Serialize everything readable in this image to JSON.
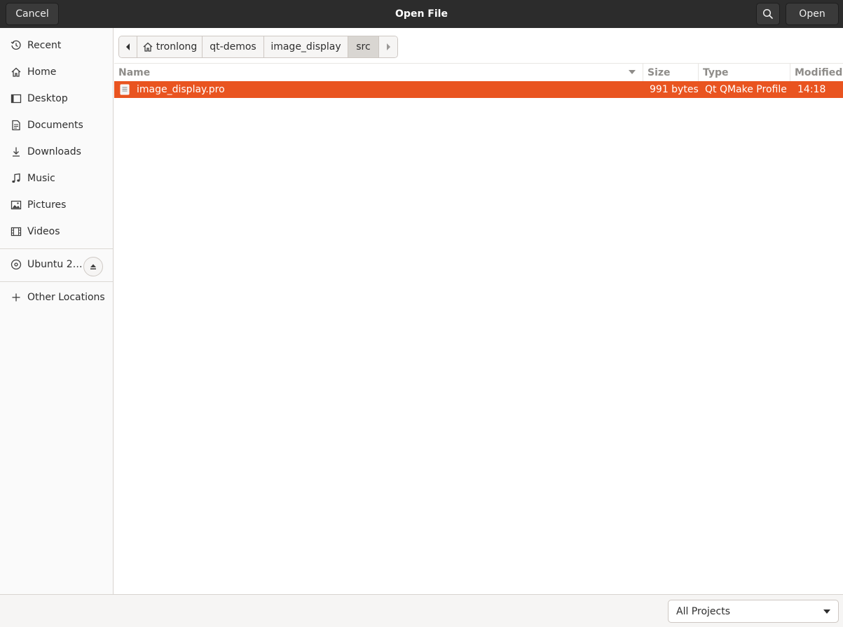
{
  "header": {
    "title": "Open File",
    "cancel_label": "Cancel",
    "open_label": "Open"
  },
  "sidebar": {
    "items": [
      {
        "label": "Recent",
        "icon": "clock-icon"
      },
      {
        "label": "Home",
        "icon": "home-icon"
      },
      {
        "label": "Desktop",
        "icon": "desktop-icon"
      },
      {
        "label": "Documents",
        "icon": "documents-icon"
      },
      {
        "label": "Downloads",
        "icon": "download-icon"
      },
      {
        "label": "Music",
        "icon": "music-icon"
      },
      {
        "label": "Pictures",
        "icon": "pictures-icon"
      },
      {
        "label": "Videos",
        "icon": "videos-icon"
      }
    ],
    "device": {
      "label": "Ubuntu 2…",
      "icon": "disc-icon",
      "eject_icon": "eject-icon"
    },
    "other_locations": {
      "label": "Other Locations",
      "icon": "plus-icon"
    }
  },
  "pathbar": {
    "segments": [
      "tronlong",
      "qt-demos",
      "image_display",
      "src"
    ],
    "active": "src"
  },
  "filelist": {
    "columns": {
      "name": "Name",
      "size": "Size",
      "type": "Type",
      "modified": "Modified"
    },
    "sort_column": "Name",
    "rows": [
      {
        "name": "image_display.pro",
        "size": "991 bytes",
        "type": "Qt QMake Profile",
        "modified": "14:18",
        "selected": true
      }
    ]
  },
  "filter": {
    "selected": "All Projects"
  },
  "colors": {
    "accent": "#e95420",
    "header_bg": "#2c2c2c"
  }
}
